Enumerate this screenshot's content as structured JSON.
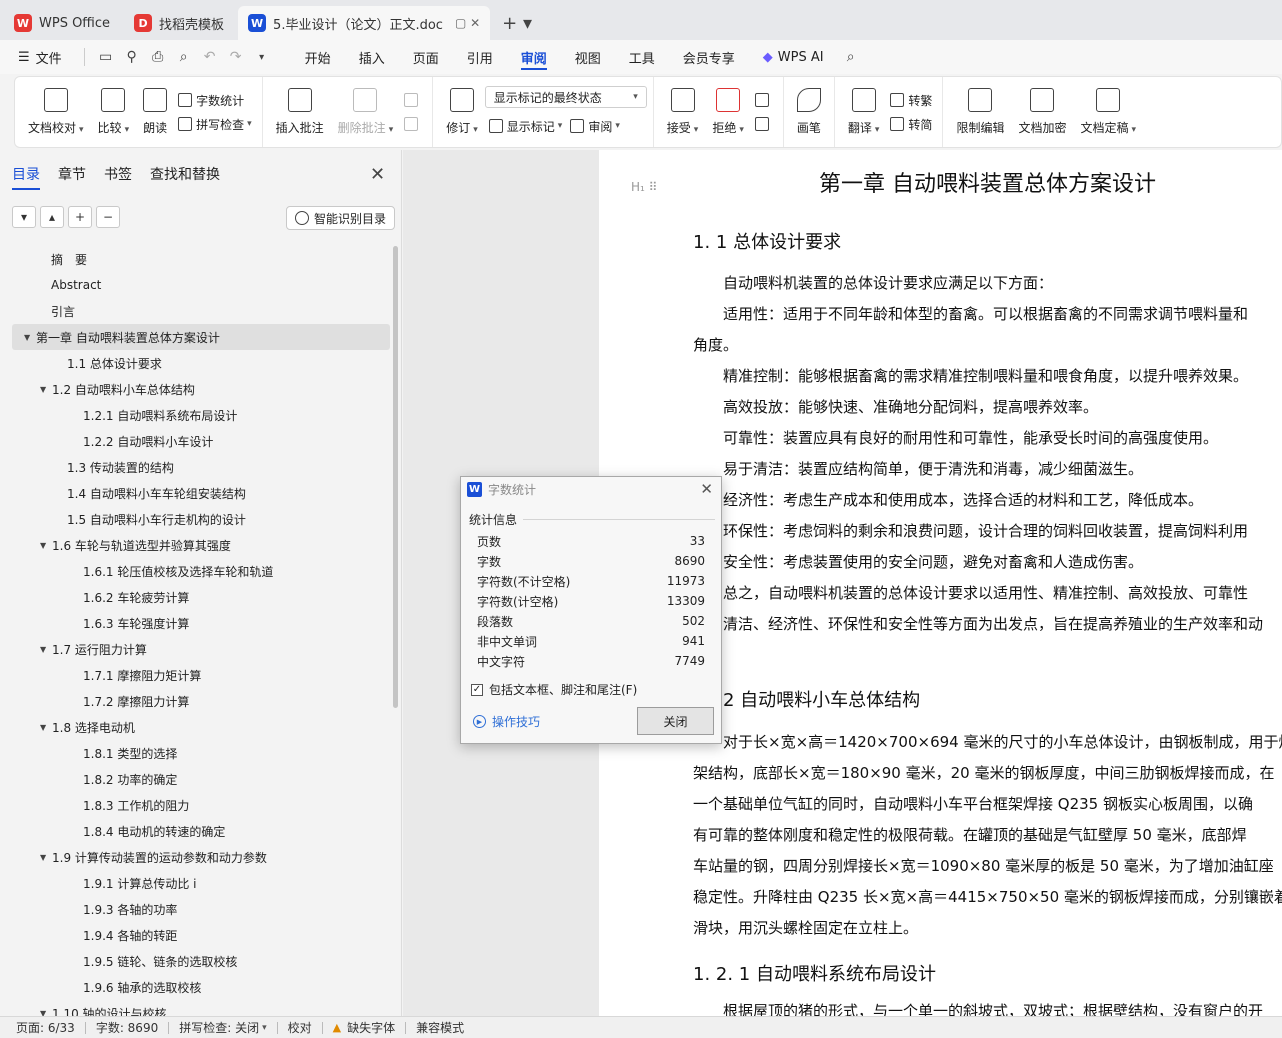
{
  "tabs": [
    {
      "label": "WPS Office",
      "color": "#e53935",
      "glyph": "W"
    },
    {
      "label": "找稻壳模板",
      "color": "#e53935",
      "glyph": "D"
    },
    {
      "label": "5.毕业设计（论文）正文.doc",
      "color": "#1a4fd6",
      "glyph": "W",
      "active": true
    }
  ],
  "menu": {
    "file_label": "文件",
    "items": [
      "开始",
      "插入",
      "页面",
      "引用",
      "审阅",
      "视图",
      "工具",
      "会员专享"
    ],
    "active": "审阅",
    "ai_label": "WPS AI"
  },
  "ribbon": {
    "doc_check": "文档校对",
    "compare": "比较",
    "read_aloud": "朗读",
    "word_count": "字数统计",
    "spell_check": "拼写检查",
    "insert_comment": "插入批注",
    "delete_comment": "删除批注",
    "revise": "修订",
    "markup_select": "显示标记的最终状态",
    "show_markup": "显示标记",
    "review": "审阅",
    "accept": "接受",
    "reject": "拒绝",
    "pen": "画笔",
    "translate": "翻译",
    "to_traditional": "转繁",
    "to_simplified": "转简",
    "restrict_edit": "限制编辑",
    "doc_encrypt": "文档加密",
    "doc_finalize": "文档定稿"
  },
  "leftpanel": {
    "tabs": [
      "目录",
      "章节",
      "书签",
      "查找和替换"
    ],
    "smart_label": "智能识别目录",
    "toc": [
      {
        "text": "摘　要",
        "level": 1
      },
      {
        "text": "Abstract",
        "level": 1
      },
      {
        "text": "引言",
        "level": 1
      },
      {
        "text": "第一章  自动喂料装置总体方案设计",
        "level": 0,
        "arrow": true,
        "active": true
      },
      {
        "text": "1.1 总体设计要求",
        "level": 2
      },
      {
        "text": "1.2 自动喂料小车总体结构",
        "level": 1.5,
        "arrow": true
      },
      {
        "text": "1.2.1 自动喂料系统布局设计",
        "level": 3
      },
      {
        "text": "1.2.2 自动喂料小车设计",
        "level": 3
      },
      {
        "text": "1.3 传动装置的结构",
        "level": 2
      },
      {
        "text": "1.4 自动喂料小车车轮组安装结构",
        "level": 2
      },
      {
        "text": "1.5 自动喂料小车行走机构的设计",
        "level": 2
      },
      {
        "text": "1.6 车轮与轨道选型并验算其强度",
        "level": 1.5,
        "arrow": true
      },
      {
        "text": "1.6.1 轮压值校核及选择车轮和轨道",
        "level": 3
      },
      {
        "text": "1.6.2 车轮疲劳计算",
        "level": 3
      },
      {
        "text": "1.6.3 车轮强度计算",
        "level": 3
      },
      {
        "text": "1.7  运行阻力计算",
        "level": 1.5,
        "arrow": true
      },
      {
        "text": "1.7.1 摩擦阻力矩计算",
        "level": 3
      },
      {
        "text": "1.7.2 摩擦阻力计算",
        "level": 3
      },
      {
        "text": "1.8  选择电动机",
        "level": 1.5,
        "arrow": true
      },
      {
        "text": "1.8.1 类型的选择",
        "level": 3
      },
      {
        "text": "1.8.2 功率的确定",
        "level": 3
      },
      {
        "text": "1.8.3 工作机的阻力",
        "level": 3
      },
      {
        "text": "1.8.4 电动机的转速的确定",
        "level": 3
      },
      {
        "text": "1.9 计算传动装置的运动参数和动力参数",
        "level": 1.5,
        "arrow": true
      },
      {
        "text": "1.9.1  计算总传动比 i",
        "level": 3
      },
      {
        "text": "1.9.3  各轴的功率",
        "level": 3
      },
      {
        "text": "1.9.4 各轴的转距",
        "level": 3
      },
      {
        "text": "1.9.5 链轮、链条的选取校核",
        "level": 3
      },
      {
        "text": "1.9.6  轴承的选取校核",
        "level": 3
      },
      {
        "text": "1.10 轴的设计与校核",
        "level": 1.5,
        "arrow": true
      }
    ]
  },
  "document": {
    "title": "第一章  自动喂料装置总体方案设计",
    "h_1_1": "1. 1 总体设计要求",
    "paragraphs": [
      "自动喂料机装置的总体设计要求应满足以下方面：",
      "适用性：适用于不同年龄和体型的畜禽。可以根据畜禽的不同需求调节喂料量和",
      "角度。",
      "精准控制：能够根据畜禽的需求精准控制喂料量和喂食角度，以提升喂养效果。",
      "高效投放：能够快速、准确地分配饲料，提高喂养效率。",
      "可靠性：装置应具有良好的耐用性和可靠性，能承受长时间的高强度使用。",
      "易于清洁：装置应结构简单，便于清洗和消毒，减少细菌滋生。",
      "经济性：考虑生产成本和使用成本，选择合适的材料和工艺，降低成本。",
      "环保性：考虑饲料的剩余和浪费问题，设计合理的饲料回收装置，提高饲料利用",
      "安全性：考虑装置使用的安全问题，避免对畜禽和人造成伤害。",
      "总之，自动喂料机装置的总体设计要求以适用性、精准控制、高效投放、可靠性",
      "清洁、经济性、环保性和安全性等方面为出发点，旨在提高养殖业的生产效率和动"
    ],
    "h_1_2": "2 自动喂料小车总体结构",
    "paragraphs2": [
      "对于长×宽×高＝1420×700×694 毫米的尺寸的小车总体设计，由钢板制成，用于焊",
      "架结构，底部长×宽＝180×90 毫米，20 毫米的钢板厚度，中间三肋钢板焊接而成，在",
      "一个基础单位气缸的同时，自动喂料小车平台框架焊接 Q235 钢板实心板周围，以确",
      "有可靠的整体刚度和稳定性的极限荷载。在罐顶的基础是气缸壁厚 50 毫米，底部焊",
      "车站量的钢，四周分别焊接长×宽＝1090×80 毫米厚的板是 50 毫米，为了增加油缸座",
      "稳定性。升降柱由 Q235 长×宽×高＝4415×750×50 毫米的钢板焊接而成，分别镶嵌着",
      "滑块，用沉头螺栓固定在立柱上。"
    ],
    "h_1_2_1": "1. 2. 1 自动喂料系统布局设计",
    "last_line": "根据屋顶的猪的形式，与一个单一的斜坡式，双坡式；根据壁结构，没有窗户的开"
  },
  "dialog": {
    "title": "字数统计",
    "section": "统计信息",
    "stats": [
      {
        "label": "页数",
        "value": "33"
      },
      {
        "label": "字数",
        "value": "8690"
      },
      {
        "label": "字符数(不计空格)",
        "value": "11973"
      },
      {
        "label": "字符数(计空格)",
        "value": "13309"
      },
      {
        "label": "段落数",
        "value": "502"
      },
      {
        "label": "非中文单词",
        "value": "941"
      },
      {
        "label": "中文字符",
        "value": "7749"
      }
    ],
    "include_label": "包括文本框、脚注和尾注(F)",
    "include_checked": true,
    "tips_label": "操作技巧",
    "close_label": "关闭"
  },
  "statusbar": {
    "page": "页面: 6/33",
    "words": "字数: 8690",
    "spell": "拼写检查: 关闭",
    "proof": "校对",
    "missing_font": "缺失字体",
    "compat": "兼容模式"
  }
}
